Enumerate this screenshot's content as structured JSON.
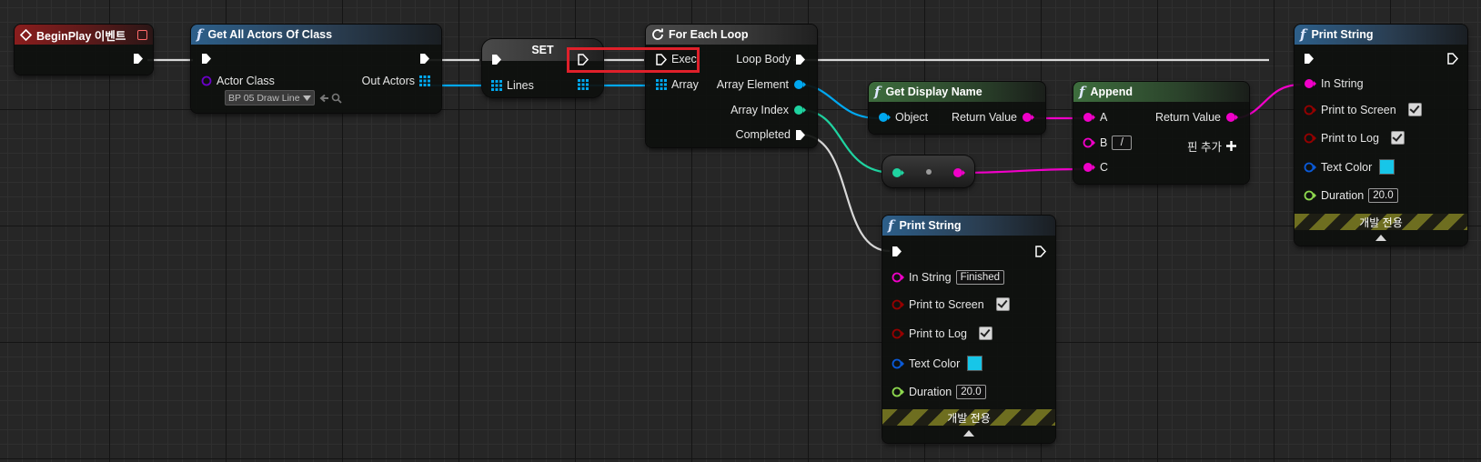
{
  "nodes": {
    "begin_play": {
      "title": "BeginPlay 이벤트"
    },
    "get_all_actors": {
      "title": "Get All Actors Of Class",
      "actor_class_label": "Actor Class",
      "actor_class_value": "BP 05 Draw Line",
      "out_actors_label": "Out Actors"
    },
    "set": {
      "title": "SET",
      "lines_label": "Lines"
    },
    "for_each": {
      "title": "For Each Loop",
      "exec_label": "Exec",
      "array_label": "Array",
      "loop_body_label": "Loop Body",
      "array_element_label": "Array Element",
      "array_index_label": "Array Index",
      "completed_label": "Completed"
    },
    "get_display_name": {
      "title": "Get Display Name",
      "object_label": "Object",
      "return_label": "Return Value"
    },
    "append": {
      "title": "Append",
      "a_label": "A",
      "b_label": "B",
      "b_value": "/",
      "c_label": "C",
      "return_label": "Return Value",
      "add_pin_label": "핀 추가"
    },
    "print_string_top": {
      "title": "Print String",
      "in_string_label": "In String",
      "print_screen_label": "Print to Screen",
      "print_log_label": "Print to Log",
      "text_color_label": "Text Color",
      "duration_label": "Duration",
      "duration_value": "20.0",
      "dev_only_label": "개발 전용"
    },
    "print_string_bottom": {
      "title": "Print String",
      "in_string_label": "In String",
      "in_string_value": "Finished",
      "print_screen_label": "Print to Screen",
      "print_log_label": "Print to Log",
      "text_color_label": "Text Color",
      "duration_label": "Duration",
      "duration_value": "20.0",
      "dev_only_label": "개발 전용"
    }
  },
  "colors": {
    "exec": "#ffffff",
    "object": "#00a8f0",
    "string": "#f000c8",
    "integer": "#1fd3a0",
    "color_struct": "#0a5ad8",
    "float": "#8ed84e",
    "bool": "#950000",
    "class": "#6a00c8",
    "text_color_swatch": "#17c6e8",
    "highlight": "#e0202a"
  }
}
